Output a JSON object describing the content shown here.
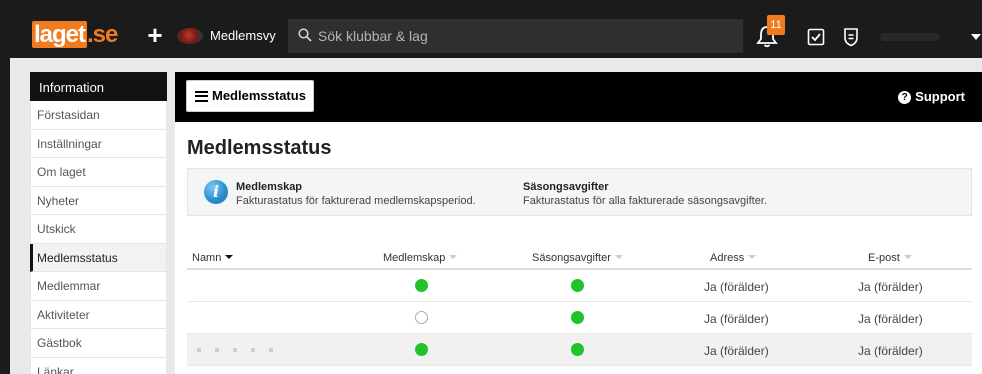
{
  "header": {
    "logo_part1": "laget",
    "logo_part2": ".se",
    "club_name": "Medlemsvy",
    "search_placeholder": "Sök klubbar & lag",
    "notification_count": "11"
  },
  "sidebar": {
    "heading": "Information",
    "items": [
      {
        "label": "Förstasidan"
      },
      {
        "label": "Inställningar"
      },
      {
        "label": "Om laget"
      },
      {
        "label": "Nyheter"
      },
      {
        "label": "Utskick"
      },
      {
        "label": "Medlemsstatus",
        "active": true
      },
      {
        "label": "Medlemmar"
      },
      {
        "label": "Aktiviteter"
      },
      {
        "label": "Gästbok"
      },
      {
        "label": "Länkar"
      }
    ]
  },
  "main": {
    "menu_button": "Medlemsstatus",
    "support_label": "Support",
    "title": "Medlemsstatus",
    "info": {
      "col1_title": "Medlemskap",
      "col1_text": "Fakturastatus för fakturerad medlemskapsperiod.",
      "col2_title": "Säsongsavgifter",
      "col2_text": "Fakturastatus för alla fakturerade säsongsavgifter."
    },
    "table": {
      "columns": [
        "Namn",
        "Medlemskap",
        "Säsongsavgifter",
        "Adress",
        "E-post"
      ],
      "rows": [
        {
          "name": "",
          "medlemskap": "paid",
          "sasong": "paid",
          "adress": "Ja (förälder)",
          "epost": "Ja (förälder)"
        },
        {
          "name": "",
          "medlemskap": "none",
          "sasong": "paid",
          "adress": "Ja (förälder)",
          "epost": "Ja (förälder)"
        },
        {
          "name": "",
          "medlemskap": "paid",
          "sasong": "paid",
          "adress": "Ja (förälder)",
          "epost": "Ja (förälder)"
        }
      ]
    }
  },
  "colors": {
    "brand": "#f07c1f",
    "status_paid": "#22c22a",
    "topbar": "#1b1b1b"
  }
}
